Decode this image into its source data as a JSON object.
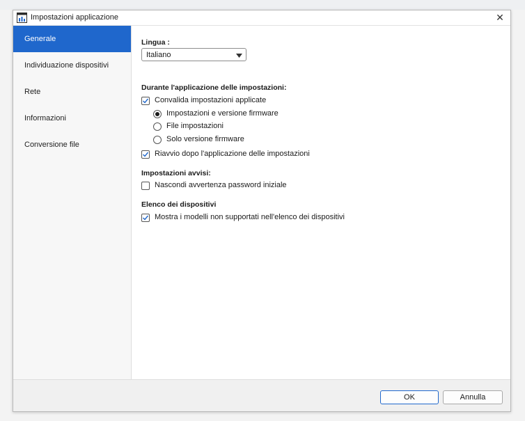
{
  "window": {
    "title": "Impostazioni applicazione",
    "close_label": "✕"
  },
  "sidebar": {
    "items": [
      {
        "label": "Generale",
        "active": true
      },
      {
        "label": "Individuazione dispositivi"
      },
      {
        "label": "Rete"
      },
      {
        "label": "Informazioni"
      },
      {
        "label": "Conversione file"
      }
    ]
  },
  "general": {
    "language": {
      "label": "Lingua :",
      "value": "Italiano"
    },
    "apply_section": {
      "title": "Durante l'applicazione delle impostazioni:",
      "validate": {
        "label": "Convalida impostazioni applicate",
        "checked": true
      },
      "options": [
        {
          "label": "Impostazioni e versione firmware",
          "selected": true
        },
        {
          "label": "File impostazioni",
          "selected": false
        },
        {
          "label": "Solo versione firmware",
          "selected": false
        }
      ],
      "restart": {
        "label": "Riavvio dopo l'applicazione delle impostazioni",
        "checked": true
      }
    },
    "warnings_section": {
      "title": "Impostazioni avvisi:",
      "hide_password": {
        "label": "Nascondi avvertenza password iniziale",
        "checked": false
      }
    },
    "devices_section": {
      "title": "Elenco dei dispositivi",
      "show_unsupported": {
        "label": "Mostra i modelli non supportati nell'elenco dei dispositivi",
        "checked": true
      }
    }
  },
  "footer": {
    "ok_label": "OK",
    "cancel_label": "Annulla"
  },
  "colors": {
    "accent": "#1f67cc"
  }
}
